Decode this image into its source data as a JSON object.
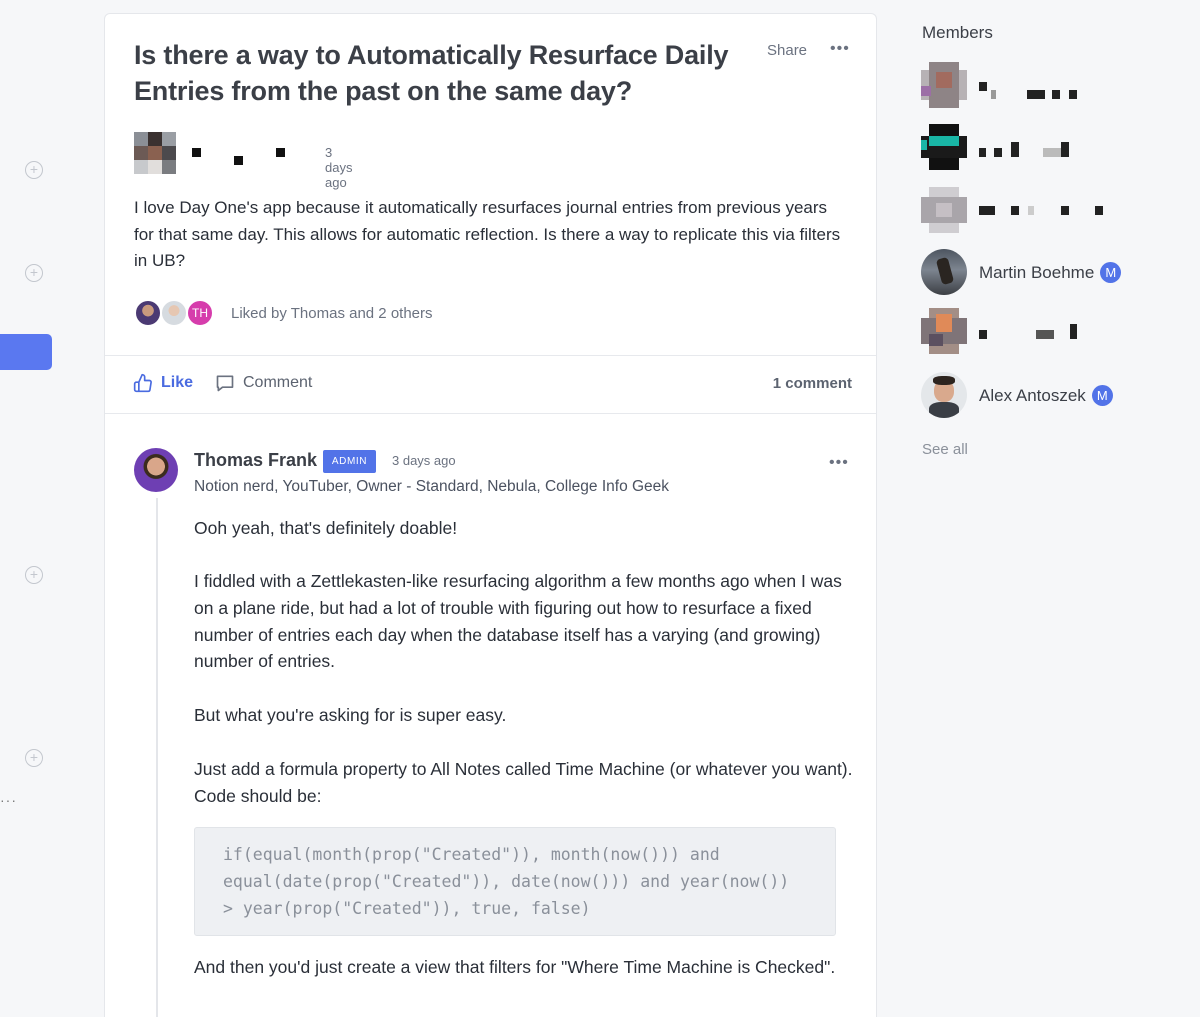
{
  "post": {
    "title": "Is there a way to Automatically Resurface Daily Entries from the past on the same day?",
    "share_label": "Share",
    "more_label": "•••",
    "time": "3 days ago",
    "body": "I love Day One's app because it automatically resurfaces journal entries from previous years for that same day. This allows for automatic reflection. Is there a way to replicate this via filters in UB?",
    "liker_initials": "TH",
    "liked_by": "Liked by Thomas and 2 others"
  },
  "actions": {
    "like_label": "Like",
    "comment_label": "Comment",
    "comment_count": "1 comment"
  },
  "comment": {
    "author": "Thomas Frank",
    "badge": "ADMIN",
    "time": "3 days ago",
    "subtitle": "Notion nerd, YouTuber, Owner - Standard, Nebula, College Info Geek",
    "paragraphs": [
      "Ooh yeah, that's definitely doable!",
      "I fiddled with a Zettlekasten-like resurfacing algorithm a few months ago when I was on a plane ride, but had a lot of trouble with figuring out how to resurface a fixed number of entries each day when the database itself has a varying (and growing) number of entries.",
      "But what you're asking for is super easy.",
      "Just add a formula property to All Notes called Time Machine (or whatever you want). Code should be:",
      "And then you'd just create a view that filters for \"Where Time Machine is Checked\"."
    ],
    "code": "if(equal(month(prop(\"Created\")), month(now())) and\nequal(date(prop(\"Created\")), date(now())) and year(now())\n> year(prop(\"Created\")), true, false)"
  },
  "sidebar": {
    "title": "Members",
    "members": [
      {
        "name": "Martin Boehme",
        "badge": "M"
      },
      {
        "name": "Alex Antoszek",
        "badge": "M"
      }
    ],
    "see_all": "See all"
  },
  "colors": {
    "accent": "#5273e8",
    "like_blue": "#4a6be0",
    "th_pink": "#d63dac"
  }
}
